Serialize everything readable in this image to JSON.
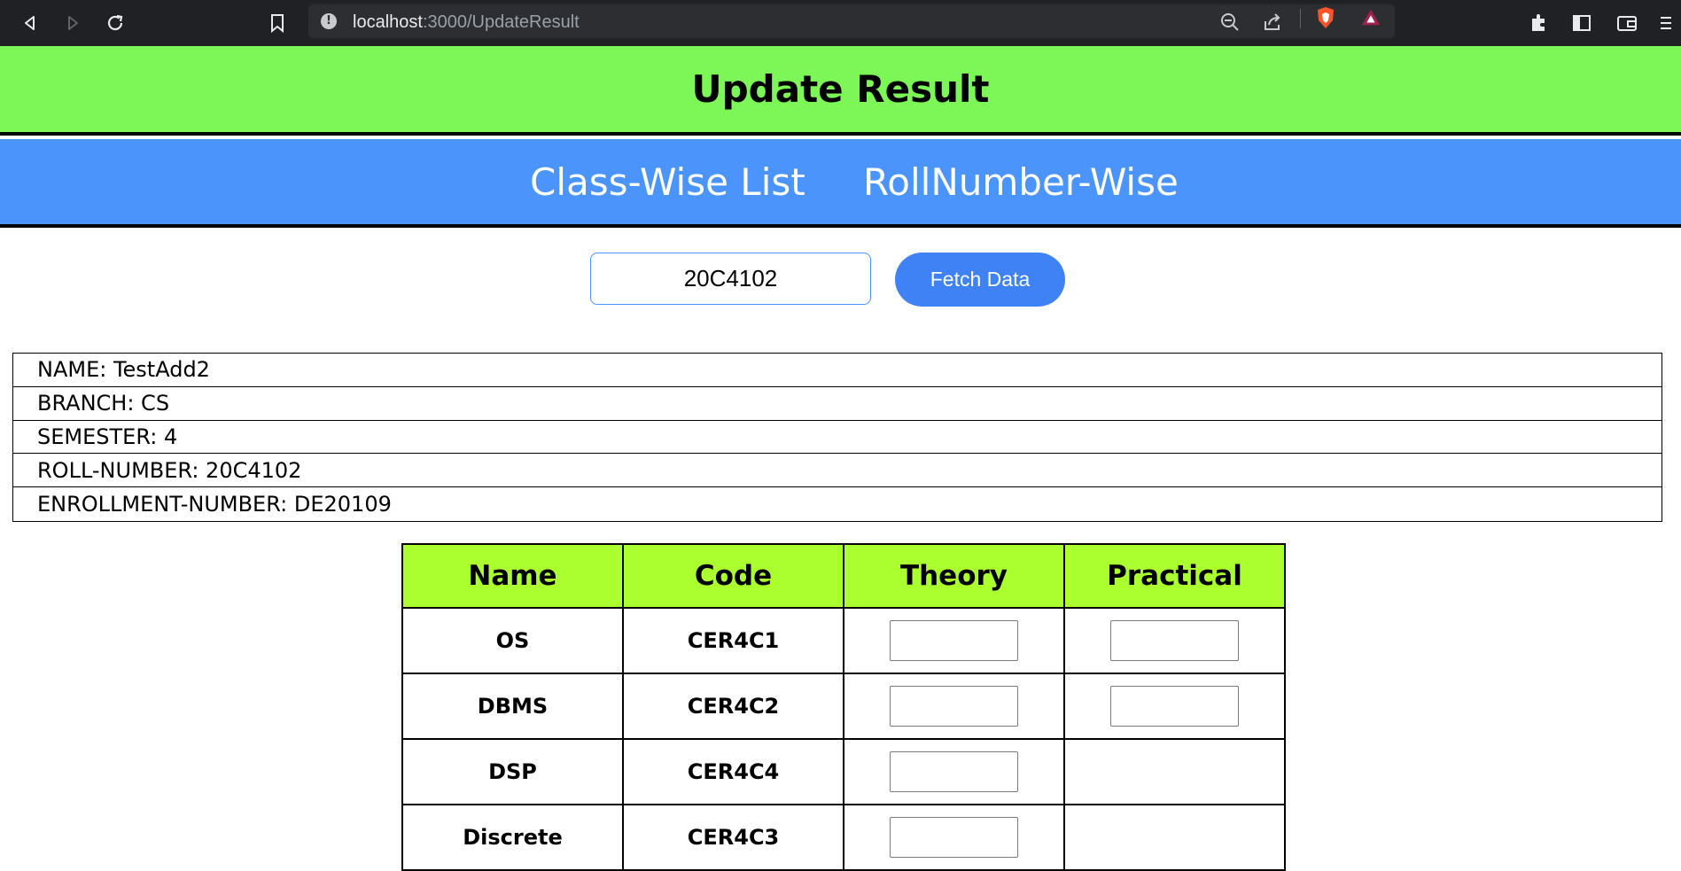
{
  "browser": {
    "url_host": "localhost",
    "url_path": ":3000/UpdateResult",
    "icons": [
      "back-icon",
      "forward-icon",
      "reload-icon",
      "bookmark-icon",
      "info-icon",
      "zoom-out-icon",
      "share-icon",
      "brave-shield-icon",
      "brave-rewards-icon",
      "extensions-icon",
      "sidebar-icon",
      "wallet-icon",
      "menu-icon"
    ]
  },
  "header": {
    "title": "Update Result",
    "title_bg": "#7cf757"
  },
  "nav": {
    "bg": "#4a94fb",
    "links": [
      {
        "label": "Class-Wise List"
      },
      {
        "label": "RollNumber-Wise"
      }
    ]
  },
  "search": {
    "value": "20C4102",
    "button_label": "Fetch Data"
  },
  "student": {
    "rows": [
      {
        "text": "NAME: TestAdd2"
      },
      {
        "text": "BRANCH: CS"
      },
      {
        "text": "SEMESTER: 4"
      },
      {
        "text": "ROLL-NUMBER: 20C4102"
      },
      {
        "text": "ENROLLMENT-NUMBER: DE20109"
      }
    ]
  },
  "marks": {
    "header_bg": "#acff2f",
    "headers": [
      "Name",
      "Code",
      "Theory",
      "Practical"
    ],
    "rows": [
      {
        "name": "OS",
        "code": "CER4C1",
        "has_theory": true,
        "has_practical": true
      },
      {
        "name": "DBMS",
        "code": "CER4C2",
        "has_theory": true,
        "has_practical": true
      },
      {
        "name": "DSP",
        "code": "CER4C4",
        "has_theory": true,
        "has_practical": false
      },
      {
        "name": "Discrete",
        "code": "CER4C3",
        "has_theory": true,
        "has_practical": false
      }
    ]
  }
}
